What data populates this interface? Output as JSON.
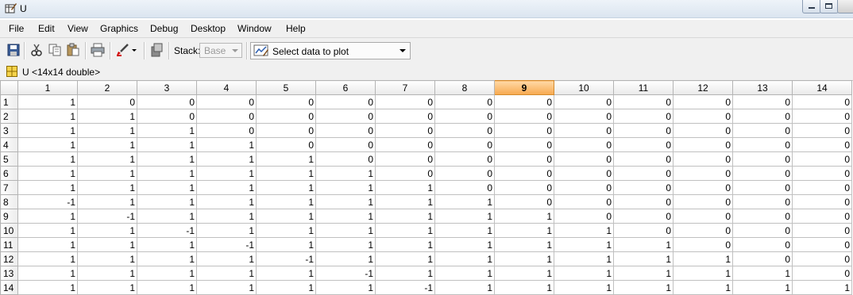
{
  "window": {
    "title": "U",
    "icon": "variable-editor-icon"
  },
  "menu": [
    "File",
    "Edit",
    "View",
    "Graphics",
    "Debug",
    "Desktop",
    "Window",
    "Help"
  ],
  "toolbar": {
    "buttons": [
      "save-icon",
      "cut-icon",
      "copy-icon",
      "paste-icon",
      "print-icon",
      "brush-icon",
      "dropdown-arrow-icon",
      "export-icon"
    ],
    "stack_label": "Stack:",
    "stack_value": "Base",
    "plot_select_label": "Select data to plot"
  },
  "variable": {
    "label": "U <14x14 double>",
    "icon": "grid-icon"
  },
  "grid": {
    "columns": [
      "1",
      "2",
      "3",
      "4",
      "5",
      "6",
      "7",
      "8",
      "9",
      "10",
      "11",
      "12",
      "13",
      "14"
    ],
    "selected_column": "9",
    "rows": [
      {
        "label": "1",
        "cells": [
          "1",
          "0",
          "0",
          "0",
          "0",
          "0",
          "0",
          "0",
          "0",
          "0",
          "0",
          "0",
          "0",
          "0"
        ]
      },
      {
        "label": "2",
        "cells": [
          "1",
          "1",
          "0",
          "0",
          "0",
          "0",
          "0",
          "0",
          "0",
          "0",
          "0",
          "0",
          "0",
          "0"
        ]
      },
      {
        "label": "3",
        "cells": [
          "1",
          "1",
          "1",
          "0",
          "0",
          "0",
          "0",
          "0",
          "0",
          "0",
          "0",
          "0",
          "0",
          "0"
        ]
      },
      {
        "label": "4",
        "cells": [
          "1",
          "1",
          "1",
          "1",
          "0",
          "0",
          "0",
          "0",
          "0",
          "0",
          "0",
          "0",
          "0",
          "0"
        ]
      },
      {
        "label": "5",
        "cells": [
          "1",
          "1",
          "1",
          "1",
          "1",
          "0",
          "0",
          "0",
          "0",
          "0",
          "0",
          "0",
          "0",
          "0"
        ]
      },
      {
        "label": "6",
        "cells": [
          "1",
          "1",
          "1",
          "1",
          "1",
          "1",
          "0",
          "0",
          "0",
          "0",
          "0",
          "0",
          "0",
          "0"
        ]
      },
      {
        "label": "7",
        "cells": [
          "1",
          "1",
          "1",
          "1",
          "1",
          "1",
          "1",
          "0",
          "0",
          "0",
          "0",
          "0",
          "0",
          "0"
        ]
      },
      {
        "label": "8",
        "cells": [
          "-1",
          "1",
          "1",
          "1",
          "1",
          "1",
          "1",
          "1",
          "0",
          "0",
          "0",
          "0",
          "0",
          "0"
        ]
      },
      {
        "label": "9",
        "cells": [
          "1",
          "-1",
          "1",
          "1",
          "1",
          "1",
          "1",
          "1",
          "1",
          "0",
          "0",
          "0",
          "0",
          "0"
        ]
      },
      {
        "label": "10",
        "cells": [
          "1",
          "1",
          "-1",
          "1",
          "1",
          "1",
          "1",
          "1",
          "1",
          "1",
          "0",
          "0",
          "0",
          "0"
        ]
      },
      {
        "label": "11",
        "cells": [
          "1",
          "1",
          "1",
          "-1",
          "1",
          "1",
          "1",
          "1",
          "1",
          "1",
          "1",
          "0",
          "0",
          "0"
        ]
      },
      {
        "label": "12",
        "cells": [
          "1",
          "1",
          "1",
          "1",
          "-1",
          "1",
          "1",
          "1",
          "1",
          "1",
          "1",
          "1",
          "0",
          "0"
        ]
      },
      {
        "label": "13",
        "cells": [
          "1",
          "1",
          "1",
          "1",
          "1",
          "-1",
          "1",
          "1",
          "1",
          "1",
          "1",
          "1",
          "1",
          "0"
        ]
      },
      {
        "label": "14",
        "cells": [
          "1",
          "1",
          "1",
          "1",
          "1",
          "1",
          "-1",
          "1",
          "1",
          "1",
          "1",
          "1",
          "1",
          "1"
        ]
      }
    ]
  }
}
